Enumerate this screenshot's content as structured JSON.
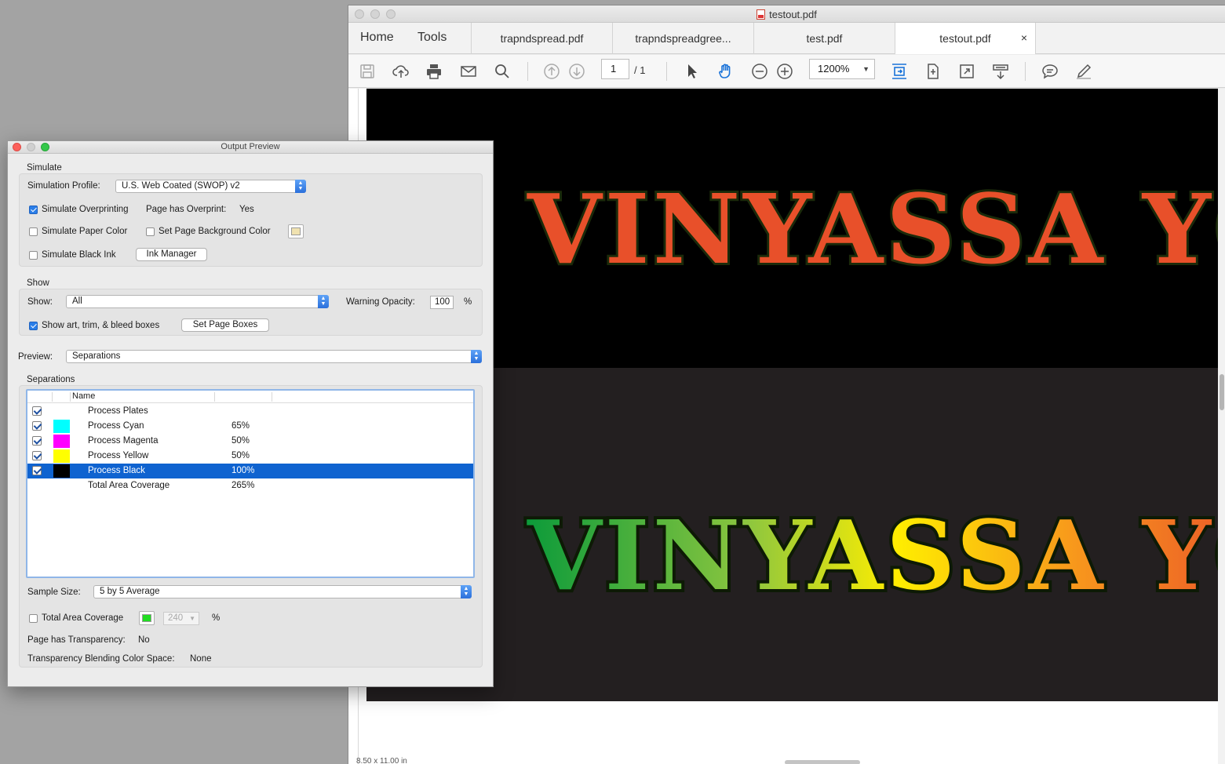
{
  "acrobat": {
    "window_title": "testout.pdf",
    "nav": {
      "home": "Home",
      "tools": "Tools"
    },
    "tabs": [
      {
        "label": "trapndspread.pdf"
      },
      {
        "label": "trapndspreadgree..."
      },
      {
        "label": "test.pdf"
      },
      {
        "label": "testout.pdf",
        "close": "×"
      }
    ],
    "page_input": "1",
    "page_total": "/ 1",
    "zoom": "1200%",
    "status": "8.50 x 11.00 in",
    "artwork_text": "VINYASSA YOG"
  },
  "output_preview": {
    "title": "Output Preview",
    "simulate": {
      "group_label": "Simulate",
      "profile_label": "Simulation Profile:",
      "profile_value": "U.S. Web Coated (SWOP) v2",
      "overprinting_label": "Simulate Overprinting",
      "overprinting_checked": true,
      "page_overprint_label": "Page has Overprint:",
      "page_overprint_value": "Yes",
      "paper_color_label": "Simulate Paper Color",
      "bg_color_label": "Set Page Background Color",
      "bg_swatch_color": "#f0e2b0",
      "black_ink_label": "Simulate Black Ink",
      "ink_manager_button": "Ink Manager"
    },
    "show": {
      "group_label": "Show",
      "show_label": "Show:",
      "show_value": "All",
      "warning_opacity_label": "Warning Opacity:",
      "warning_opacity_value": "100",
      "percent": "%",
      "boxes_label": "Show art, trim, & bleed boxes",
      "boxes_checked": true,
      "set_page_boxes_button": "Set Page Boxes"
    },
    "preview": {
      "label": "Preview:",
      "value": "Separations"
    },
    "separations": {
      "group_label": "Separations",
      "column_name": "Name",
      "rows": [
        {
          "name": "Process Plates",
          "percent": "",
          "swatch": "",
          "checked": true
        },
        {
          "name": "Process Cyan",
          "percent": "65%",
          "swatch": "#00ffff",
          "checked": true
        },
        {
          "name": "Process Magenta",
          "percent": "50%",
          "swatch": "#ff00ff",
          "checked": true
        },
        {
          "name": "Process Yellow",
          "percent": "50%",
          "swatch": "#ffff00",
          "checked": true
        },
        {
          "name": "Process Black",
          "percent": "100%",
          "swatch": "#000000",
          "checked": true,
          "selected": true
        },
        {
          "name": "Total Area Coverage",
          "percent": "265%",
          "swatch": "",
          "checked": false
        }
      ]
    },
    "sample_size": {
      "label": "Sample Size:",
      "value": "5 by 5 Average"
    },
    "tac": {
      "label": "Total Area Coverage",
      "swatch_color": "#22dd22",
      "value": "240",
      "percent": "%"
    },
    "transparency": {
      "page_label": "Page has Transparency:",
      "page_value": "No",
      "blend_label": "Transparency Blending Color Space:",
      "blend_value": "None"
    }
  },
  "colors": {
    "accent": "#0f63d0",
    "selection": "#0f63d0"
  }
}
